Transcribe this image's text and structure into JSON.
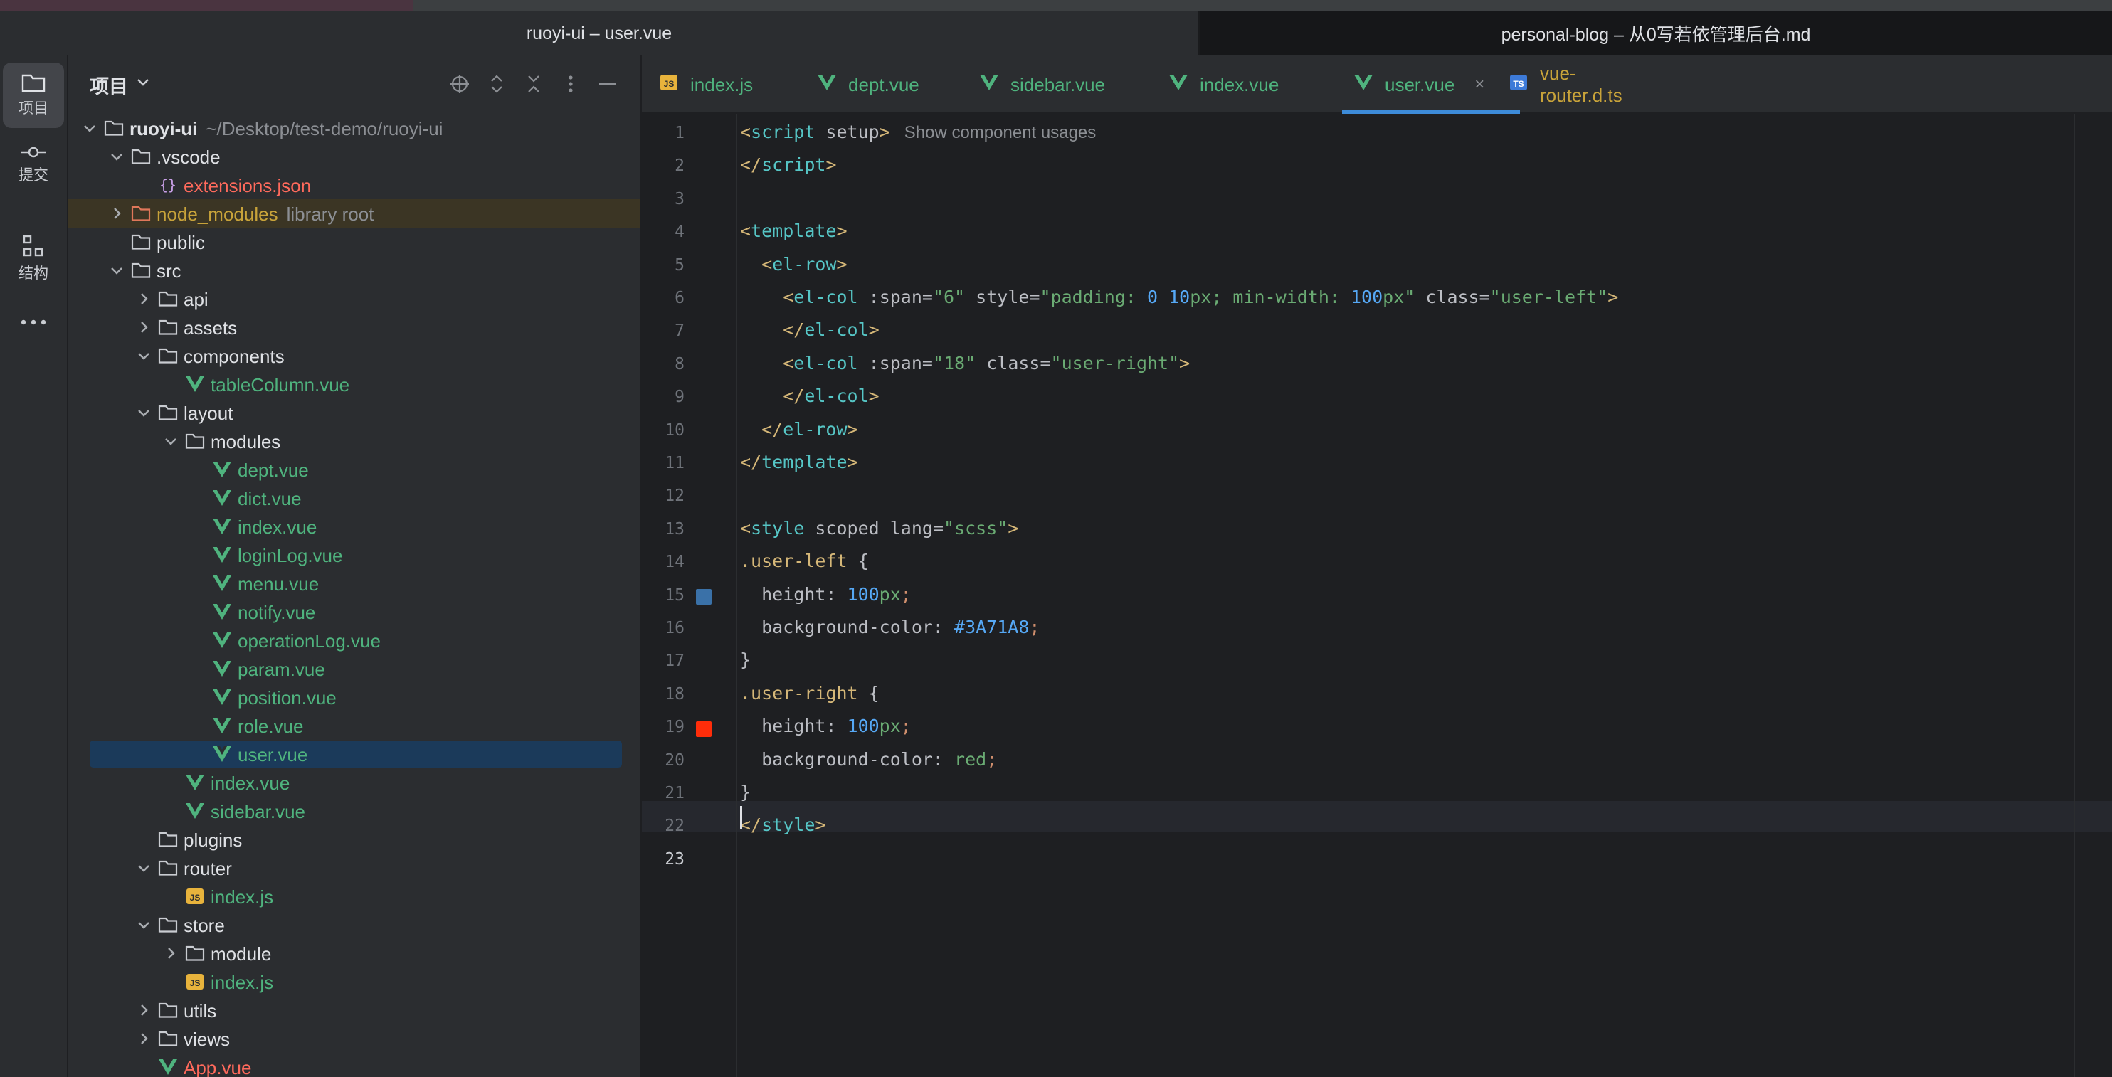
{
  "window_tabs": {
    "left": "ruoyi-ui – user.vue",
    "right": "personal-blog – 从0写若依管理后台.md"
  },
  "activity": {
    "items": [
      {
        "label": "项目",
        "icon": "folder-icon",
        "active": true
      },
      {
        "label": "提交",
        "icon": "commit-icon",
        "active": false
      },
      {
        "label": "结构",
        "icon": "structure-icon",
        "active": false
      },
      {
        "label": "",
        "icon": "more-icon",
        "active": false
      }
    ]
  },
  "project": {
    "title": "项目",
    "header_icons": [
      "locate-icon",
      "expand-all-icon",
      "collapse-all-icon",
      "options-icon",
      "hide-icon"
    ],
    "tree": [
      {
        "indent": 0,
        "expand": "down",
        "type": "folder",
        "name": "ruoyi-ui",
        "bold": true,
        "extra": "~/Desktop/test-demo/ruoyi-ui"
      },
      {
        "indent": 1,
        "expand": "down",
        "type": "folder",
        "name": ".vscode"
      },
      {
        "indent": 2,
        "expand": "",
        "type": "json",
        "name": "extensions.json"
      },
      {
        "indent": 1,
        "expand": "right",
        "type": "modfolder",
        "name": "node_modules",
        "extra": "library root",
        "highlight": true
      },
      {
        "indent": 1,
        "expand": "",
        "type": "folder",
        "name": "public"
      },
      {
        "indent": 1,
        "expand": "down",
        "type": "folder",
        "name": "src"
      },
      {
        "indent": 2,
        "expand": "right",
        "type": "folder",
        "name": "api"
      },
      {
        "indent": 2,
        "expand": "right",
        "type": "folder",
        "name": "assets"
      },
      {
        "indent": 2,
        "expand": "down",
        "type": "folder",
        "name": "components"
      },
      {
        "indent": 3,
        "expand": "",
        "type": "vue",
        "name": "tableColumn.vue"
      },
      {
        "indent": 2,
        "expand": "down",
        "type": "folder",
        "name": "layout"
      },
      {
        "indent": 3,
        "expand": "down",
        "type": "folder",
        "name": "modules"
      },
      {
        "indent": 4,
        "expand": "",
        "type": "vue",
        "name": "dept.vue"
      },
      {
        "indent": 4,
        "expand": "",
        "type": "vue",
        "name": "dict.vue"
      },
      {
        "indent": 4,
        "expand": "",
        "type": "vue",
        "name": "index.vue"
      },
      {
        "indent": 4,
        "expand": "",
        "type": "vue",
        "name": "loginLog.vue"
      },
      {
        "indent": 4,
        "expand": "",
        "type": "vue",
        "name": "menu.vue"
      },
      {
        "indent": 4,
        "expand": "",
        "type": "vue",
        "name": "notify.vue"
      },
      {
        "indent": 4,
        "expand": "",
        "type": "vue",
        "name": "operationLog.vue"
      },
      {
        "indent": 4,
        "expand": "",
        "type": "vue",
        "name": "param.vue"
      },
      {
        "indent": 4,
        "expand": "",
        "type": "vue",
        "name": "position.vue"
      },
      {
        "indent": 4,
        "expand": "",
        "type": "vue",
        "name": "role.vue"
      },
      {
        "indent": 4,
        "expand": "",
        "type": "vue",
        "name": "user.vue",
        "selected": true
      },
      {
        "indent": 3,
        "expand": "",
        "type": "vue",
        "name": "index.vue"
      },
      {
        "indent": 3,
        "expand": "",
        "type": "vue",
        "name": "sidebar.vue"
      },
      {
        "indent": 2,
        "expand": "",
        "type": "folder",
        "name": "plugins"
      },
      {
        "indent": 2,
        "expand": "down",
        "type": "folder",
        "name": "router"
      },
      {
        "indent": 3,
        "expand": "",
        "type": "js",
        "name": "index.js"
      },
      {
        "indent": 2,
        "expand": "down",
        "type": "folder",
        "name": "store"
      },
      {
        "indent": 3,
        "expand": "right",
        "type": "folder",
        "name": "module"
      },
      {
        "indent": 3,
        "expand": "",
        "type": "js",
        "name": "index.js"
      },
      {
        "indent": 2,
        "expand": "right",
        "type": "folder",
        "name": "utils"
      },
      {
        "indent": 2,
        "expand": "right",
        "type": "folder",
        "name": "views"
      },
      {
        "indent": 2,
        "expand": "",
        "type": "vuered",
        "name": "App.vue"
      }
    ]
  },
  "editor_tabs": [
    {
      "type": "js",
      "name": "index.js"
    },
    {
      "type": "vue",
      "name": "dept.vue"
    },
    {
      "type": "vue",
      "name": "sidebar.vue"
    },
    {
      "type": "vue",
      "name": "index.vue"
    },
    {
      "type": "vue",
      "name": "user.vue",
      "active": true,
      "close": "×"
    },
    {
      "type": "ts",
      "name": "vue-router.d.ts"
    }
  ],
  "colors": {
    "swatch_16": "#3A71A8",
    "swatch_20": "#FF2D0A",
    "accent": "#3d8bd9"
  },
  "editor": {
    "current_line": 23,
    "line_numbers": [
      "1",
      "2",
      "3",
      "4",
      "5",
      "6",
      "7",
      "8",
      "9",
      "10",
      "11",
      "12",
      "13",
      "14",
      "15",
      "16",
      "17",
      "18",
      "19",
      "20",
      "21",
      "22",
      "23"
    ],
    "lines": [
      [
        [
          "tg",
          "<"
        ],
        [
          "tn",
          "script"
        ],
        [
          "at",
          " setup"
        ],
        [
          "tg",
          ">"
        ],
        [
          "hint",
          "   Show component usages"
        ]
      ],
      [
        [
          "tg",
          "</"
        ],
        [
          "tn",
          "script"
        ],
        [
          "tg",
          ">"
        ]
      ],
      [],
      [
        [
          "tg",
          "<"
        ],
        [
          "tn",
          "template"
        ],
        [
          "tg",
          ">"
        ]
      ],
      [
        [
          "pu",
          "  "
        ],
        [
          "tg",
          "<"
        ],
        [
          "tn",
          "el-row"
        ],
        [
          "tg",
          ">"
        ]
      ],
      [
        [
          "pu",
          "    "
        ],
        [
          "tg",
          "<"
        ],
        [
          "tn",
          "el-col"
        ],
        [
          "at",
          " :span="
        ],
        [
          "st",
          "\"6\""
        ],
        [
          "at",
          " style="
        ],
        [
          "st",
          "\"padding: "
        ],
        [
          "nm",
          "0 10"
        ],
        [
          "st",
          "px; min-width: "
        ],
        [
          "nm",
          "100"
        ],
        [
          "st",
          "px\""
        ],
        [
          "at",
          " class="
        ],
        [
          "st",
          "\"user-left\""
        ],
        [
          "tg",
          ">"
        ]
      ],
      [
        [
          "pu",
          "    "
        ],
        [
          "tg",
          "</"
        ],
        [
          "tn",
          "el-col"
        ],
        [
          "tg",
          ">"
        ]
      ],
      [
        [
          "pu",
          "    "
        ],
        [
          "tg",
          "<"
        ],
        [
          "tn",
          "el-col"
        ],
        [
          "at",
          " :span="
        ],
        [
          "st",
          "\"18\""
        ],
        [
          "at",
          " class="
        ],
        [
          "st",
          "\"user-right\""
        ],
        [
          "tg",
          ">"
        ]
      ],
      [
        [
          "pu",
          "    "
        ],
        [
          "tg",
          "</"
        ],
        [
          "tn",
          "el-col"
        ],
        [
          "tg",
          ">"
        ]
      ],
      [
        [
          "pu",
          "  "
        ],
        [
          "tg",
          "</"
        ],
        [
          "tn",
          "el-row"
        ],
        [
          "tg",
          ">"
        ]
      ],
      [
        [
          "tg",
          "</"
        ],
        [
          "tn",
          "template"
        ],
        [
          "tg",
          ">"
        ]
      ],
      [],
      [
        [
          "tg",
          "<"
        ],
        [
          "tn",
          "style"
        ],
        [
          "at",
          " scoped lang="
        ],
        [
          "st",
          "\"scss\""
        ],
        [
          "tg",
          ">"
        ]
      ],
      [
        [
          "sel-c",
          ".user-left"
        ],
        [
          "pu",
          " {"
        ]
      ],
      [
        [
          "pu",
          "  height: "
        ],
        [
          "nm",
          "100"
        ],
        [
          "st",
          "px"
        ],
        [
          "kw",
          ";"
        ]
      ],
      [
        [
          "pu",
          "  background-color: "
        ],
        [
          "nm",
          "#3A71A8"
        ],
        [
          "kw",
          ";"
        ]
      ],
      [
        [
          "pu",
          "}"
        ]
      ],
      [
        [
          "sel-c",
          ".user-right"
        ],
        [
          "pu",
          " {"
        ]
      ],
      [
        [
          "pu",
          "  height: "
        ],
        [
          "nm",
          "100"
        ],
        [
          "st",
          "px"
        ],
        [
          "kw",
          ";"
        ]
      ],
      [
        [
          "pu",
          "  background-color: "
        ],
        [
          "st",
          "red"
        ],
        [
          "kw",
          ";"
        ]
      ],
      [
        [
          "pu",
          "}"
        ]
      ],
      [
        [
          "tg",
          "</"
        ],
        [
          "tn",
          "style"
        ],
        [
          "tg",
          ">"
        ]
      ],
      []
    ]
  }
}
